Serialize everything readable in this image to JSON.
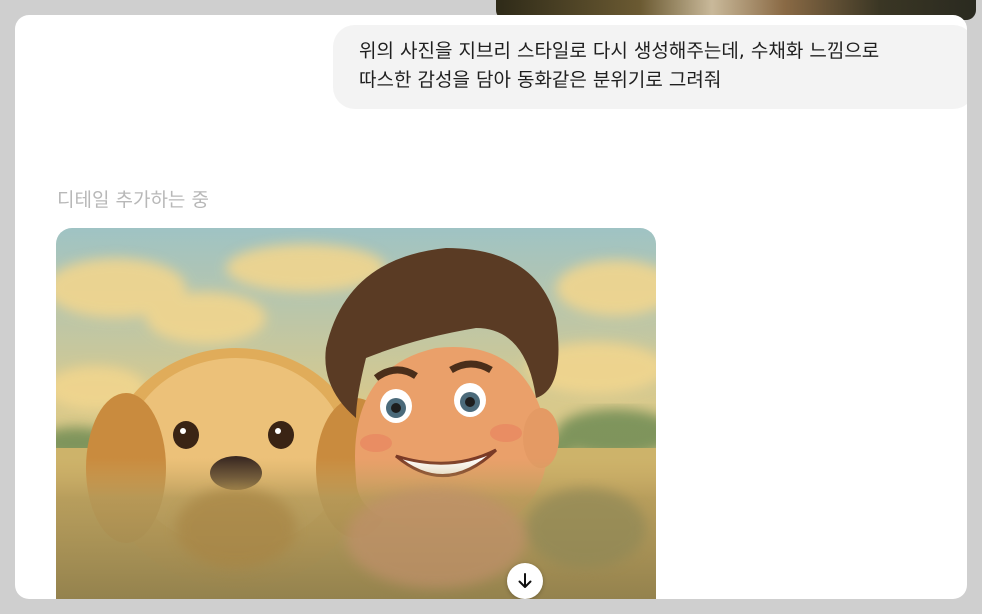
{
  "prompt_message": {
    "line1": "위의 사진을 지브리 스타일로 다시 생성해주는데, 수채화 느낌으로",
    "line2": "따스한 감성을 담아 동화같은 분위기로 그려줘"
  },
  "status": {
    "text": "디테일 추가하는 중"
  },
  "icons": {
    "scroll_down": "arrow-down-icon"
  },
  "colors": {
    "panel_bg": "#ffffff",
    "bubble_bg": "#f3f3f3",
    "status_text": "#b8b8b8",
    "outer_bg": "#cfcfcf"
  }
}
